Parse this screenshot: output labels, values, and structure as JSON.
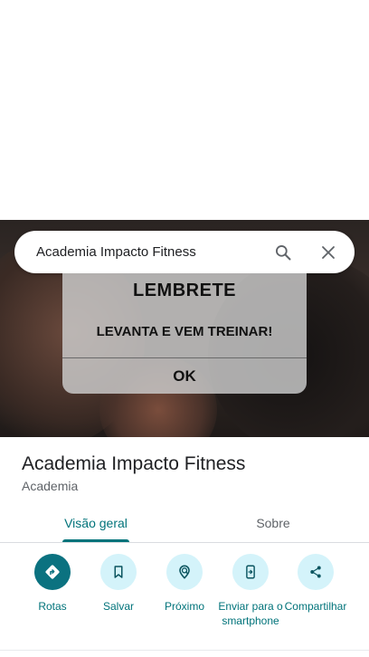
{
  "search": {
    "query": "Academia Impacto Fitness"
  },
  "dialog": {
    "title": "LEMBRETE",
    "message": "LEVANTA E VEM TREINAR!",
    "ok_label": "OK"
  },
  "place": {
    "name": "Academia Impacto Fitness",
    "category": "Academia"
  },
  "tabs": [
    {
      "label": "Visão geral",
      "active": true
    },
    {
      "label": "Sobre",
      "active": false
    }
  ],
  "actions": [
    {
      "label": "Rotas",
      "icon": "directions-icon"
    },
    {
      "label": "Salvar",
      "icon": "bookmark-icon"
    },
    {
      "label": "Próximo",
      "icon": "nearby-icon"
    },
    {
      "label": "Enviar para o smartphone",
      "icon": "send-to-phone-icon"
    },
    {
      "label": "Compartilhar",
      "icon": "share-icon"
    }
  ],
  "colors": {
    "accent": "#00737a",
    "primary_button": "#0b7280",
    "action_circle": "#d4f3fa"
  }
}
